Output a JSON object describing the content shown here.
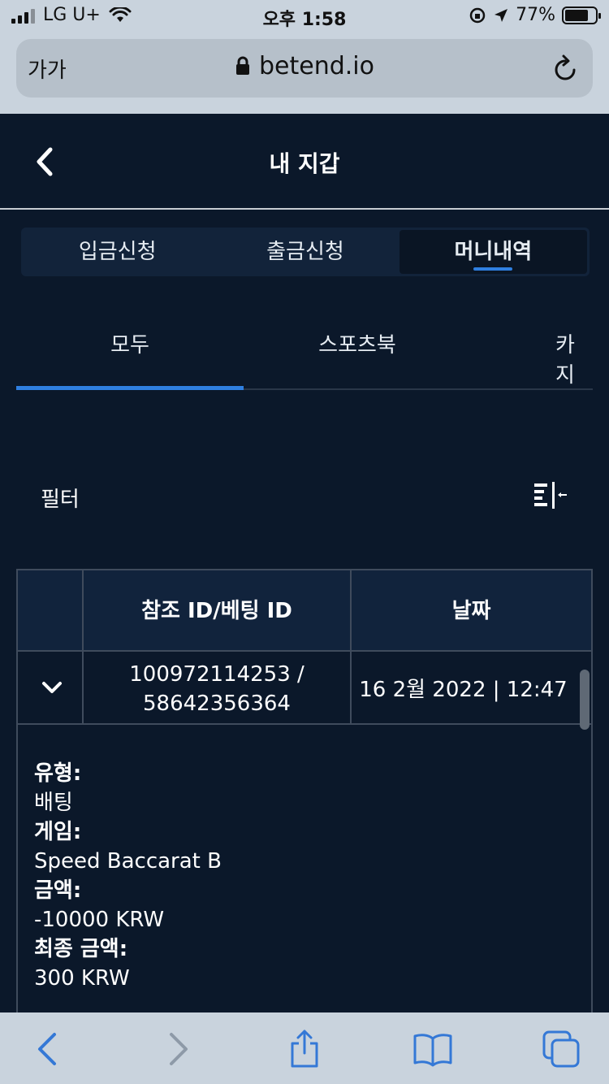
{
  "status_bar": {
    "carrier": "LG U+",
    "time": "오후 1:58",
    "battery_percent": "77%",
    "battery_level": 0.77
  },
  "browser": {
    "aa_label": "가가",
    "url": "betend.io"
  },
  "header": {
    "title": "내 지갑"
  },
  "segment_tabs": [
    {
      "label": "입금신청",
      "active": false
    },
    {
      "label": "출금신청",
      "active": false
    },
    {
      "label": "머니내역",
      "active": true
    }
  ],
  "sub_tabs": [
    {
      "label": "모두",
      "active": true
    },
    {
      "label": "스포츠북",
      "active": false
    },
    {
      "label": "카지",
      "active": false
    }
  ],
  "filter": {
    "label": "필터"
  },
  "table": {
    "headers": [
      "참조 ID/베팅 ID",
      "날짜"
    ],
    "rows": [
      {
        "ref_id": "100972114253 /",
        "bet_id": "58642356364",
        "date": "16 2월 2022 | 12:47"
      }
    ],
    "details": {
      "type_key": "유형:",
      "type_value": "배팅",
      "game_key": "게임:",
      "game_value": "Speed Baccarat B",
      "amount_key": "금액:",
      "amount_value": "-10000 KRW",
      "final_key": "최종 금액:",
      "final_value": "300 KRW"
    }
  },
  "colors": {
    "background": "#0b182a",
    "accent": "#2f7fe0",
    "ios_blue": "#3478d6"
  }
}
